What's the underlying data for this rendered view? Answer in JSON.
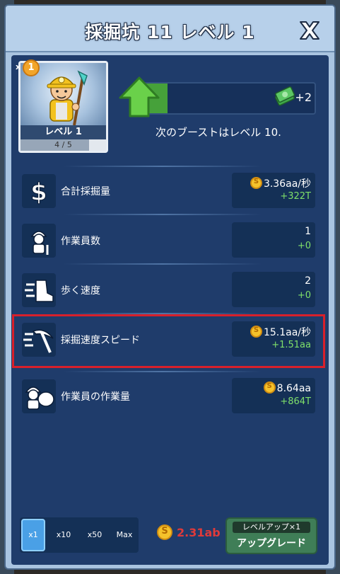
{
  "title": "採掘坑 11 レベル 1",
  "portrait": {
    "badge_prefix": "x",
    "badge_count": "1",
    "level_label": "レベル 1",
    "progress_text": "4 / 5",
    "progress_fraction": 0.8
  },
  "boost": {
    "fill_fraction": 0.17,
    "reward": "+2",
    "next_text": "次のブーストはレベル 10."
  },
  "stats": [
    {
      "label": "合計採掘量",
      "value": "3.36aa/秒",
      "delta": "+322T",
      "has_coin": true
    },
    {
      "label": "作業員数",
      "value": "1",
      "delta": "+0",
      "has_coin": false
    },
    {
      "label": "歩く速度",
      "value": "2",
      "delta": "+0",
      "has_coin": false
    },
    {
      "label": "採掘速度スピード",
      "value": "15.1aa/秒",
      "delta": "+1.51aa",
      "has_coin": true
    },
    {
      "label": "作業員の作業量",
      "value": "8.64aa",
      "delta": "+864T",
      "has_coin": true
    }
  ],
  "multiplier": {
    "options": [
      "x1",
      "x10",
      "x50",
      "Max"
    ],
    "selected": "x1"
  },
  "cost": "2.31ab",
  "upgrade": {
    "tag": "レベルアップ×1",
    "label": "アップグレード"
  },
  "colors": {
    "panel_bg": "#1f3c6b",
    "highlight": "#d8202b",
    "delta_green": "#7fe06a",
    "cost_red": "#e03a3a",
    "button_green": "#3f7e57"
  }
}
